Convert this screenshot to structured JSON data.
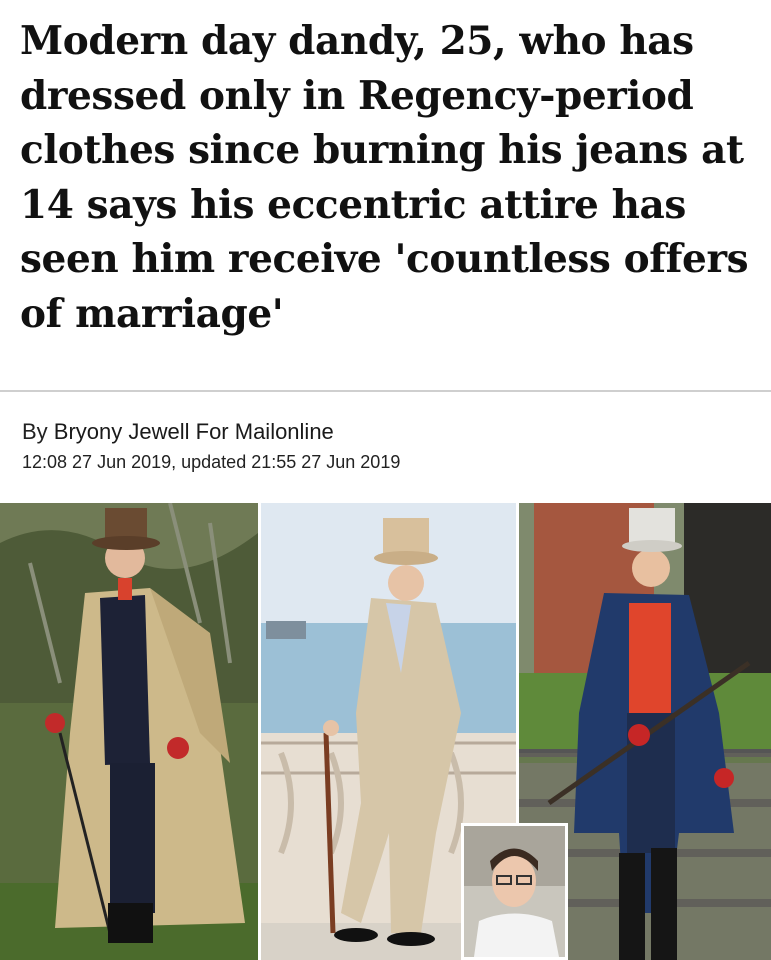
{
  "article": {
    "headline_lines": [
      "Modern day dandy, 25, who has",
      "dressed only in Regency-period",
      "clothes since burning his jeans at",
      "14 says his eccentric attire has",
      "seen him receive 'countless offers",
      "of marriage'"
    ],
    "byline_prefix": "By ",
    "author": "Bryony Jewell For Mailonline",
    "timestamp": "12:08 27 Jun 2019, updated 21:55 27 Jun 2019"
  },
  "images": [
    {
      "name": "photo-greatcoat",
      "icon": "man-in-tan-greatcoat-top-hat"
    },
    {
      "name": "photo-seaside",
      "icon": "man-in-cream-suit-by-sea"
    },
    {
      "name": "photo-blue-coat",
      "icon": "man-in-blue-tailcoat-on-steps"
    },
    {
      "name": "inset-teen-photo",
      "icon": "teenager-with-glasses"
    }
  ]
}
